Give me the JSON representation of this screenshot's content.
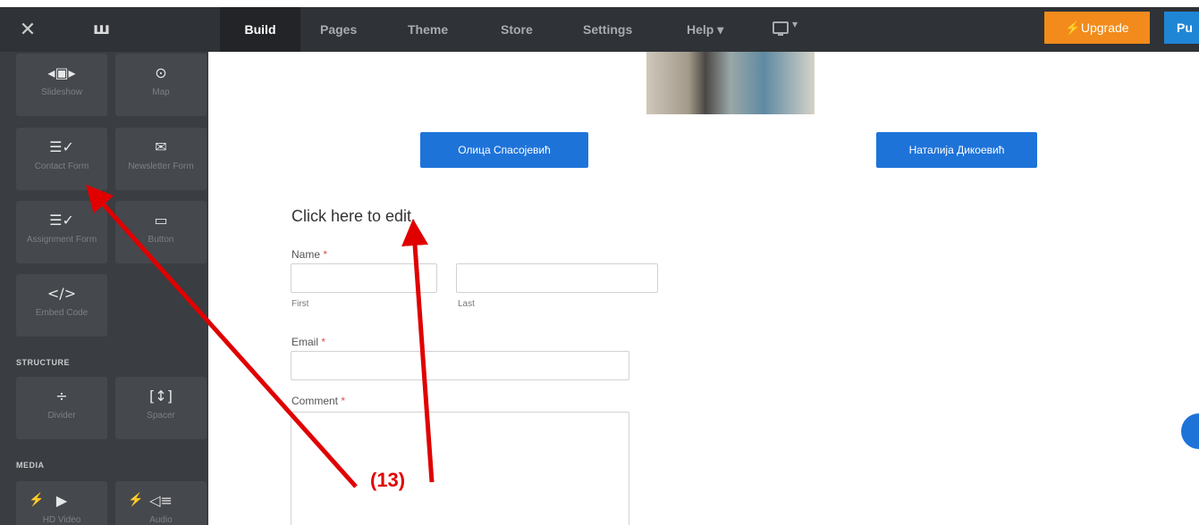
{
  "topbar": {
    "close_icon": "close-icon",
    "logo_icon": "weebly-logo-icon",
    "nav": [
      {
        "label": "Build"
      },
      {
        "label": "Pages"
      },
      {
        "label": "Theme"
      },
      {
        "label": "Store"
      },
      {
        "label": "Settings"
      },
      {
        "label": "Help ▾"
      }
    ],
    "device_caret": "▾",
    "upgrade_label": "⚡Upgrade",
    "publish_label": "Pu",
    "colors": {
      "bar": "#2f3236",
      "upgrade": "#f28b1b",
      "publish": "#1f86d6"
    }
  },
  "sidebar": {
    "tiles": [
      {
        "icon": "slideshow-icon",
        "glyph": "◂▣▸",
        "label": "Slideshow"
      },
      {
        "icon": "map-pin-icon",
        "glyph": "⊙",
        "label": "Map"
      },
      {
        "icon": "contact-form-icon",
        "glyph": "☰✓",
        "label": "Contact Form"
      },
      {
        "icon": "envelope-icon",
        "glyph": "✉",
        "label": "Newsletter Form"
      },
      {
        "icon": "assignment-form-icon",
        "glyph": "☰✓",
        "label": "Assignment Form"
      },
      {
        "icon": "button-icon",
        "glyph": "▭",
        "label": "Button"
      },
      {
        "icon": "embed-code-icon",
        "glyph": "</>",
        "label": "Embed Code"
      },
      {
        "icon": "divider-icon",
        "glyph": "÷",
        "label": "Divider"
      },
      {
        "icon": "spacer-icon",
        "glyph": "[↕]",
        "label": "Spacer"
      },
      {
        "icon": "hd-video-icon",
        "glyph": "▶",
        "label": "HD Video"
      },
      {
        "icon": "audio-icon",
        "glyph": "◁≡",
        "label": "Audio"
      }
    ],
    "sections": {
      "structure": "STRUCTURE",
      "media": "MEDIA"
    }
  },
  "canvas": {
    "person_buttons": [
      "Олица Спасојевић",
      "Наталија Дикоевић"
    ],
    "edit_title": "Click here to edit.",
    "form": {
      "name_label": "Name",
      "first_sublabel": "First",
      "last_sublabel": "Last",
      "email_label": "Email",
      "comment_label": "Comment",
      "required_mark": "*"
    }
  },
  "annotation": {
    "label": "(13)",
    "color": "#e00000"
  }
}
